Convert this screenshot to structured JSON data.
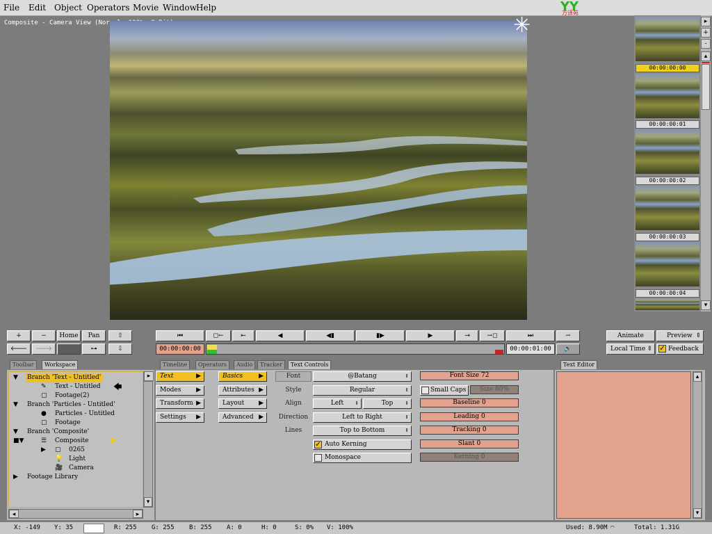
{
  "menu": [
    "File",
    "Edit",
    "Object",
    "Operators",
    "Movie",
    "Window",
    "Help"
  ],
  "logo_text": "方译苑",
  "viewer": {
    "title": "Composite - Camera View (Normal, 100%, 8 Bit)"
  },
  "thumbnails": [
    "00:00:00:00",
    "00:00:00:01",
    "00:00:00:02",
    "00:00:00:03",
    "00:00:00:04"
  ],
  "toolbar": {
    "plus": "+",
    "minus": "−",
    "home": "Home",
    "pan": "Pan"
  },
  "transport": {
    "start_time": "00:00:00:00",
    "end_time": "00:00:01:00"
  },
  "right_controls": {
    "animate": "Animate",
    "preview": "Preview",
    "local_time": "Local Time",
    "feedback": "Feedback"
  },
  "left_tabs": [
    "Toolbar",
    "Workspace"
  ],
  "center_tabs": [
    "Timeline",
    "Operators",
    "Audio",
    "Tracker",
    "Text Controls"
  ],
  "text_editor_tab": "Text Editor",
  "tree": [
    {
      "label": "Branch 'Text - Untitled'",
      "indent": 0,
      "exp": "▼",
      "selected": true
    },
    {
      "label": "Text - Untitled",
      "indent": 1,
      "exp": ""
    },
    {
      "label": "Footage(2)",
      "indent": 1,
      "exp": ""
    },
    {
      "label": "Branch 'Particles - Untitled'",
      "indent": 0,
      "exp": "▼"
    },
    {
      "label": "Particles - Untitled",
      "indent": 1,
      "exp": ""
    },
    {
      "label": "Footage",
      "indent": 1,
      "exp": ""
    },
    {
      "label": "Branch 'Composite'",
      "indent": 0,
      "exp": "▼"
    },
    {
      "label": "Composite",
      "indent": 1,
      "exp": ""
    },
    {
      "label": "0265",
      "indent": 1,
      "exp": "▶"
    },
    {
      "label": "Light",
      "indent": 1,
      "exp": ""
    },
    {
      "label": "Camera",
      "indent": 1,
      "exp": ""
    },
    {
      "label": "Footage Library",
      "indent": 0,
      "exp": "▶"
    }
  ],
  "cat_col1": [
    "Text",
    "Modes",
    "Transform",
    "Settings"
  ],
  "cat_col2": [
    "Basics",
    "Attributes",
    "Layout",
    "Advanced"
  ],
  "text_controls": {
    "font_label": "Font",
    "font_value": "@Batang",
    "style_label": "Style",
    "style_value": "Regular",
    "align_label": "Align",
    "align_h": "Left",
    "align_v": "Top",
    "direction_label": "Direction",
    "direction_value": "Left to Right",
    "lines_label": "Lines",
    "lines_value": "Top to Bottom",
    "auto_kerning": "Auto Kerning",
    "monospace": "Monospace"
  },
  "sliders": {
    "font_size": "Font Size 72",
    "small_caps": "Small Caps",
    "size": "Size 80%",
    "baseline": "Baseline 0",
    "leading": "Leading 0",
    "tracking": "Tracking 0",
    "slant": "Slant 0",
    "kerning": "Kerning 0"
  },
  "status": {
    "x": "X: -149",
    "y": "Y: 35",
    "r": "R: 255",
    "g": "G: 255",
    "b": "B: 255",
    "a": "A: 0",
    "h": "H: 0",
    "s": "S: 0%",
    "v": "V: 100%",
    "used": "Used: 8.90M",
    "total": "Total: 1.31G"
  },
  "colors": {
    "accent": "#f0c020",
    "slider": "#e3a28e",
    "editor": "#e3a28e"
  }
}
